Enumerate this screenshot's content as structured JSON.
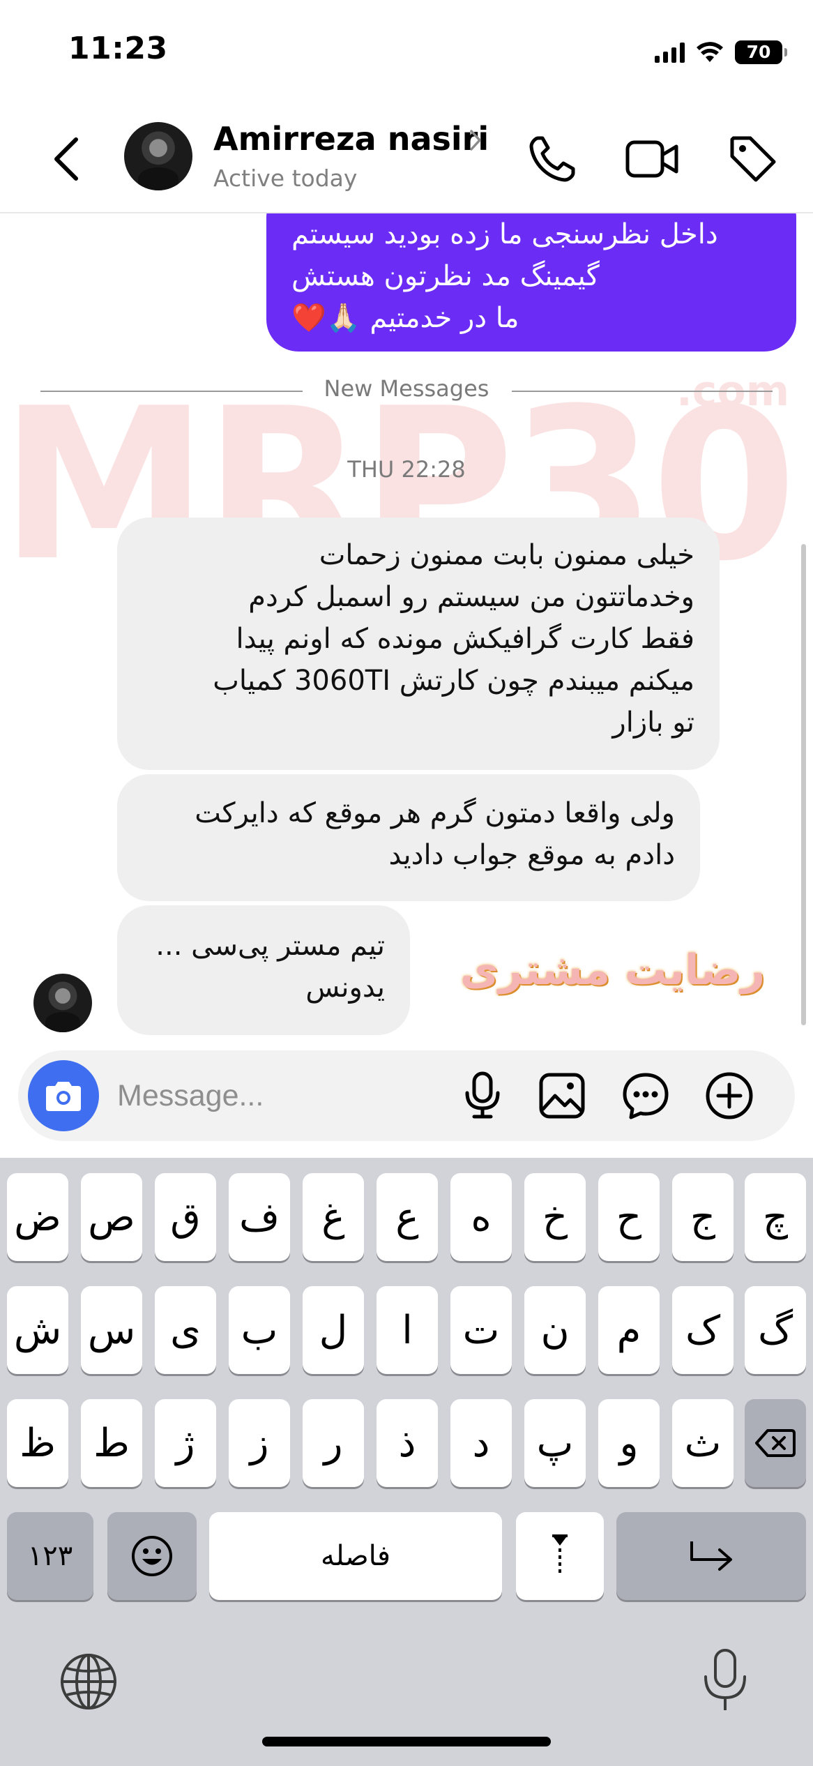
{
  "status_bar": {
    "time": "11:23",
    "battery": "70"
  },
  "header": {
    "name": "Amirreza nasiri",
    "status": "Active today",
    "icons": [
      "back-arrow-icon",
      "phone-icon",
      "video-camera-icon",
      "tag-icon"
    ]
  },
  "chat": {
    "watermark_main": "MRP30",
    "watermark_suffix": ".com",
    "outgoing": {
      "lines": [
        "داخل نظرسنجی ما زده بودید سیستم",
        "گیمینگ مد نظرتون هستش",
        "ما در خدمتیم 🙏🏻❤️"
      ]
    },
    "new_messages_label": "New Messages",
    "day_stamp": "THU 22:28",
    "incoming": [
      {
        "lines": [
          "خیلی ممنون بابت ممنون زحمات",
          "وخدماتتون من سیستم رو اسمبل کردم",
          "فقط کارت گرافیکش مونده که اونم پیدا",
          "میکنم میبندم چون کارتش 3060TI کمیاب",
          "تو بازار"
        ]
      },
      {
        "lines": [
          "ولی واقعا دمتون گرم هر موقع که دایرکت",
          "دادم به موقع جواب دادید"
        ]
      },
      {
        "lines": [
          "تیم مستر پی‌سی ...",
          "یدونس"
        ]
      }
    ],
    "sticker_text": "رضایت مشتری"
  },
  "composer": {
    "placeholder": "Message...",
    "icons": [
      "camera-icon",
      "microphone-icon",
      "image-icon",
      "sticker-chat-icon",
      "plus-icon"
    ]
  },
  "keyboard": {
    "row1": [
      "ض",
      "ص",
      "ق",
      "ف",
      "غ",
      "ع",
      "ه",
      "خ",
      "ح",
      "ج",
      "چ"
    ],
    "row2": [
      "ش",
      "س",
      "ی",
      "ب",
      "ل",
      "ا",
      "ت",
      "ن",
      "م",
      "ک",
      "گ"
    ],
    "row3": [
      "ظ",
      "ط",
      "ژ",
      "ز",
      "ر",
      "ذ",
      "د",
      "پ",
      "و",
      "ث"
    ],
    "numbers_key": "۱۲۳",
    "space_label": "فاصله",
    "icons": [
      "delete-icon",
      "emoji-icon",
      "zwnj-icon",
      "return-icon",
      "globe-icon",
      "dictation-mic-icon"
    ]
  },
  "colors": {
    "accent": "#6b2cf5",
    "camera_button": "#3f6ff0",
    "incoming_bubble": "#efefef",
    "keyboard_bg": "#d1d3d9"
  }
}
